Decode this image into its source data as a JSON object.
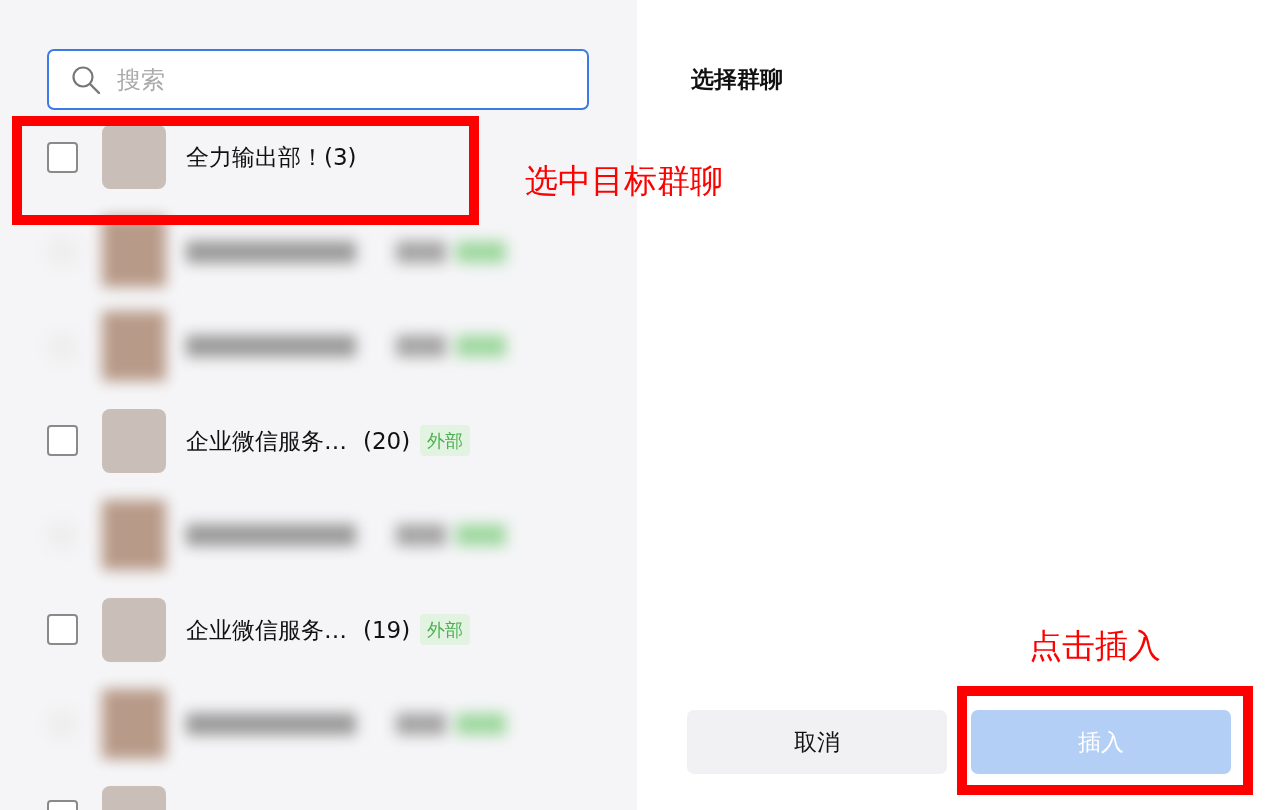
{
  "search": {
    "placeholder": "搜索"
  },
  "groups": [
    {
      "kind": "group",
      "name": "全力输出部！(3)",
      "checked": false,
      "annotation": "选中目标群聊"
    },
    {
      "kind": "blurred"
    },
    {
      "kind": "blurred"
    },
    {
      "kind": "group",
      "name": "企业微信服务…",
      "count": "(20)",
      "tag": "外部",
      "checked": false
    },
    {
      "kind": "blurred"
    },
    {
      "kind": "group",
      "name": "企业微信服务…",
      "count": "(19)",
      "tag": "外部",
      "checked": false
    },
    {
      "kind": "blurred"
    },
    {
      "kind": "partial",
      "checked": false
    }
  ],
  "dialog": {
    "title": "选择群聊",
    "buttons": [
      {
        "label": "取消",
        "kind": "secondary",
        "disabled": false
      },
      {
        "label": "插入",
        "kind": "primary",
        "disabled": true,
        "annotation": "点击插入"
      }
    ]
  }
}
